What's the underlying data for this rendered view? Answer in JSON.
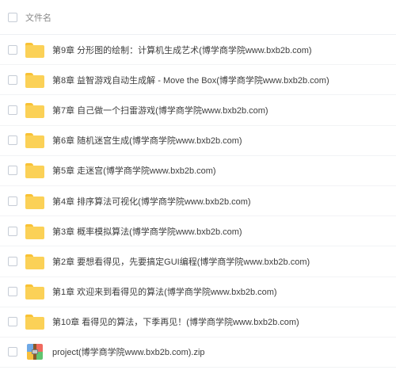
{
  "header": {
    "column_label": "文件名"
  },
  "files": [
    {
      "type": "folder",
      "name": "第9章 分形图的绘制：计算机生成艺术(博学商学院www.bxb2b.com)"
    },
    {
      "type": "folder",
      "name": "第8章 益智游戏自动生成解 - Move the Box(博学商学院www.bxb2b.com)"
    },
    {
      "type": "folder",
      "name": "第7章 自己做一个扫雷游戏(博学商学院www.bxb2b.com)"
    },
    {
      "type": "folder",
      "name": "第6章 随机迷宫生成(博学商学院www.bxb2b.com)"
    },
    {
      "type": "folder",
      "name": "第5章 走迷宫(博学商学院www.bxb2b.com)"
    },
    {
      "type": "folder",
      "name": "第4章 排序算法可视化(博学商学院www.bxb2b.com)"
    },
    {
      "type": "folder",
      "name": "第3章 概率模拟算法(博学商学院www.bxb2b.com)"
    },
    {
      "type": "folder",
      "name": "第2章 要想看得见，先要搞定GUI编程(博学商学院www.bxb2b.com)"
    },
    {
      "type": "folder",
      "name": "第1章 欢迎来到看得见的算法(博学商学院www.bxb2b.com)"
    },
    {
      "type": "folder",
      "name": "第10章 看得见的算法，下季再见！(博学商学院www.bxb2b.com)"
    },
    {
      "type": "zip",
      "name": "project(博学商学院www.bxb2b.com).zip"
    }
  ],
  "icons": {
    "folder": "folder-icon",
    "zip": "zip-archive-icon",
    "checkbox": "checkbox-icon"
  },
  "colors": {
    "folder": "#fbd157",
    "border": "#c6ccd6"
  }
}
